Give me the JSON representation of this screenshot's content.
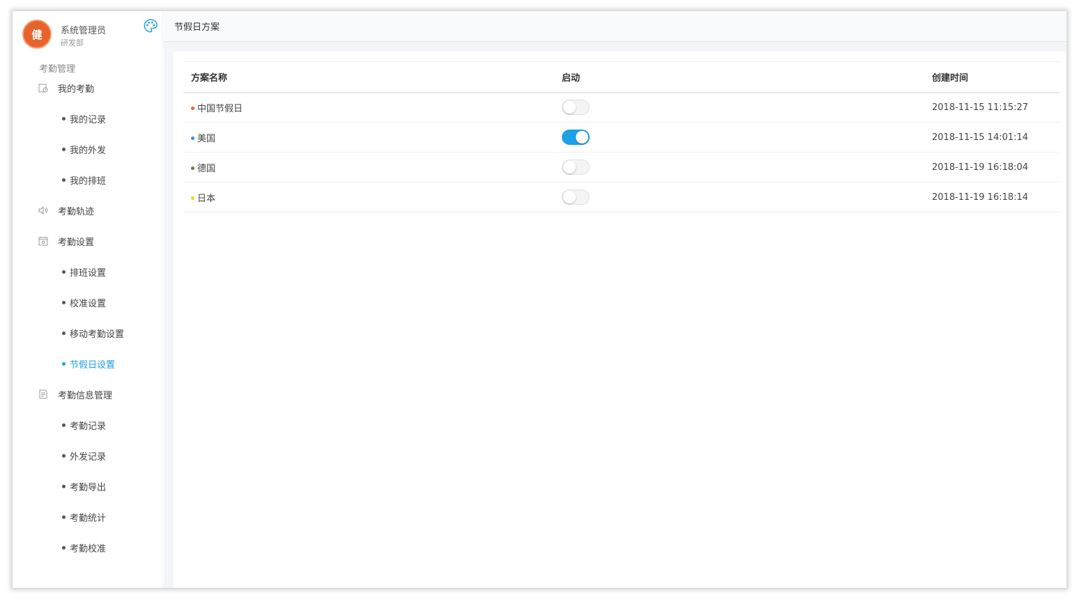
{
  "user": {
    "avatar_text": "健",
    "name": "系统管理员",
    "dept": "研发部"
  },
  "sidebar": {
    "section_title": "考勤管理",
    "groups": [
      {
        "label": "我的考勤",
        "icon": "clock-icon",
        "items": [
          {
            "label": "我的记录"
          },
          {
            "label": "我的外发"
          },
          {
            "label": "我的排班"
          }
        ]
      },
      {
        "label": "考勤轨迹",
        "icon": "speaker-icon",
        "items": []
      },
      {
        "label": "考勤设置",
        "icon": "calendar-icon",
        "items": [
          {
            "label": "排班设置"
          },
          {
            "label": "校准设置"
          },
          {
            "label": "移动考勤设置"
          },
          {
            "label": "节假日设置",
            "active": true
          }
        ]
      },
      {
        "label": "考勤信息管理",
        "icon": "document-icon",
        "items": [
          {
            "label": "考勤记录"
          },
          {
            "label": "外发记录"
          },
          {
            "label": "考勤导出"
          },
          {
            "label": "考勤统计"
          },
          {
            "label": "考勤校准"
          }
        ]
      }
    ]
  },
  "tabbar": {
    "title": "节假日方案"
  },
  "table": {
    "headers": {
      "name": "方案名称",
      "enabled": "启动",
      "created": "创建时间"
    },
    "rows": [
      {
        "name": "中国节假日",
        "dot_color": "#e8632c",
        "enabled": false,
        "created": "2018-11-15 11:15:27"
      },
      {
        "name": "美国",
        "dot_color": "#3a8ee6",
        "enabled": true,
        "created": "2018-11-15 14:01:14"
      },
      {
        "name": "德国",
        "dot_color": "#6b7a35",
        "enabled": false,
        "created": "2018-11-19 16:18:04"
      },
      {
        "name": "日本",
        "dot_color": "#f2d500",
        "enabled": false,
        "created": "2018-11-19 16:18:14"
      }
    ]
  },
  "colors": {
    "accent": "#1aa1e6",
    "brand": "#e8632c"
  }
}
